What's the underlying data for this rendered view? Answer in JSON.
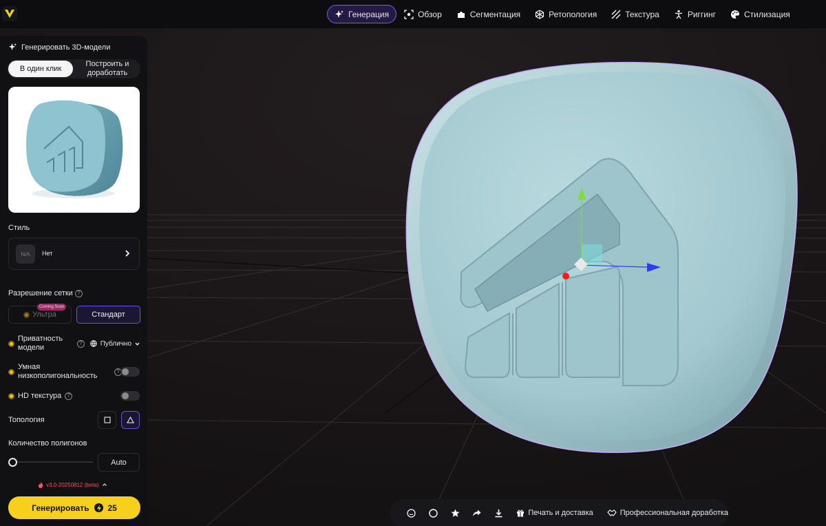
{
  "nav": {
    "items": [
      {
        "label": "Генерация",
        "icon": "sparkles-icon",
        "active": true
      },
      {
        "label": "Обзор",
        "icon": "scan-icon"
      },
      {
        "label": "Сегментация",
        "icon": "puzzle-icon"
      },
      {
        "label": "Ретопология",
        "icon": "mesh-icon"
      },
      {
        "label": "Текстура",
        "icon": "texture-stripes-icon"
      },
      {
        "label": "Риггинг",
        "icon": "figure-icon"
      },
      {
        "label": "Стилизация",
        "icon": "palette-icon"
      }
    ]
  },
  "panel": {
    "title": "Генерировать 3D-модели",
    "mode_tabs": [
      "В один клик",
      "Построить и\nдоработать"
    ],
    "style": {
      "label": "Стиль",
      "thumb": "N/A",
      "value": "Нет"
    },
    "resolution": {
      "label": "Разрешение сетки",
      "coming_soon": "Coming Soon",
      "ultra": "Ультра",
      "standard": "Стандарт"
    },
    "privacy": {
      "label": "Приватность\nмодели",
      "value": "Публично"
    },
    "smart_lowpoly": {
      "label": "Умная\nнизкополигональность"
    },
    "hd_texture": {
      "label": "HD текстура"
    },
    "topology": {
      "label": "Топология"
    },
    "polycount": {
      "label": "Количество полигонов",
      "value": "Auto"
    },
    "version": "v3.0-20250812 (beta)",
    "generate": {
      "label": "Генерировать",
      "cost": "25"
    }
  },
  "toolbar": {
    "print": "Печать и доставка",
    "pro": "Профессиональная доработка"
  },
  "colors": {
    "accent": "#7b5cf0",
    "brand_yellow": "#f7cf1d",
    "model": "#a9cdd4"
  }
}
